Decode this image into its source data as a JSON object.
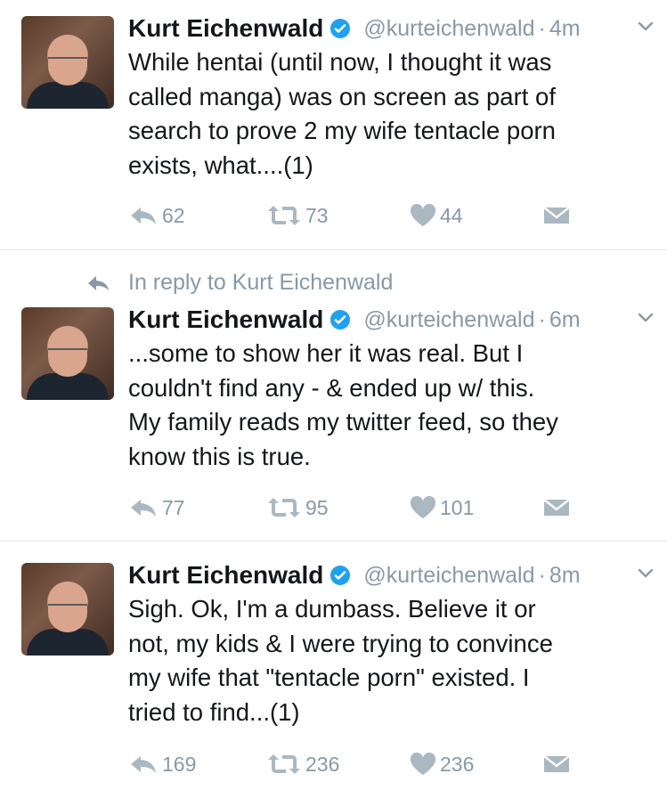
{
  "tweets": [
    {
      "name": "Kurt Eichenwald",
      "handle": "@kurteichenwald",
      "time": "4m",
      "reply_context": "",
      "lines": [
        "While hentai (until now, I thought it was",
        "called manga) was on screen as part of",
        "search to prove 2 my wife tentacle porn",
        "exists, what....(1)"
      ],
      "replies": "62",
      "retweets": "73",
      "likes": "44"
    },
    {
      "name": "Kurt Eichenwald",
      "handle": "@kurteichenwald",
      "time": "6m",
      "reply_context": "In reply to Kurt Eichenwald",
      "lines": [
        "...some to show her it was real. But I",
        "couldn't find any - & ended up w/ this.",
        "My family reads my twitter feed, so they",
        "know this is true."
      ],
      "replies": "77",
      "retweets": "95",
      "likes": "101"
    },
    {
      "name": "Kurt Eichenwald",
      "handle": "@kurteichenwald",
      "time": "8m",
      "reply_context": "",
      "lines": [
        "Sigh. Ok, I'm a dumbass. Believe it or",
        "not, my kids & I were trying to convince",
        "my wife that \"tentacle porn\" existed. I",
        "tried to find...(1)"
      ],
      "replies": "169",
      "retweets": "236",
      "likes": "236"
    }
  ],
  "separator": "·",
  "icons": {
    "verified": "verified-badge-icon",
    "caret": "chevron-down-icon",
    "reply": "reply-icon",
    "retweet": "retweet-icon",
    "like": "heart-icon",
    "dm": "direct-message-icon"
  },
  "colors": {
    "text": "#14171a",
    "muted": "#8899a6",
    "verified": "#1da1f2",
    "divider": "#e1e8ed",
    "background": "#ffffff"
  }
}
